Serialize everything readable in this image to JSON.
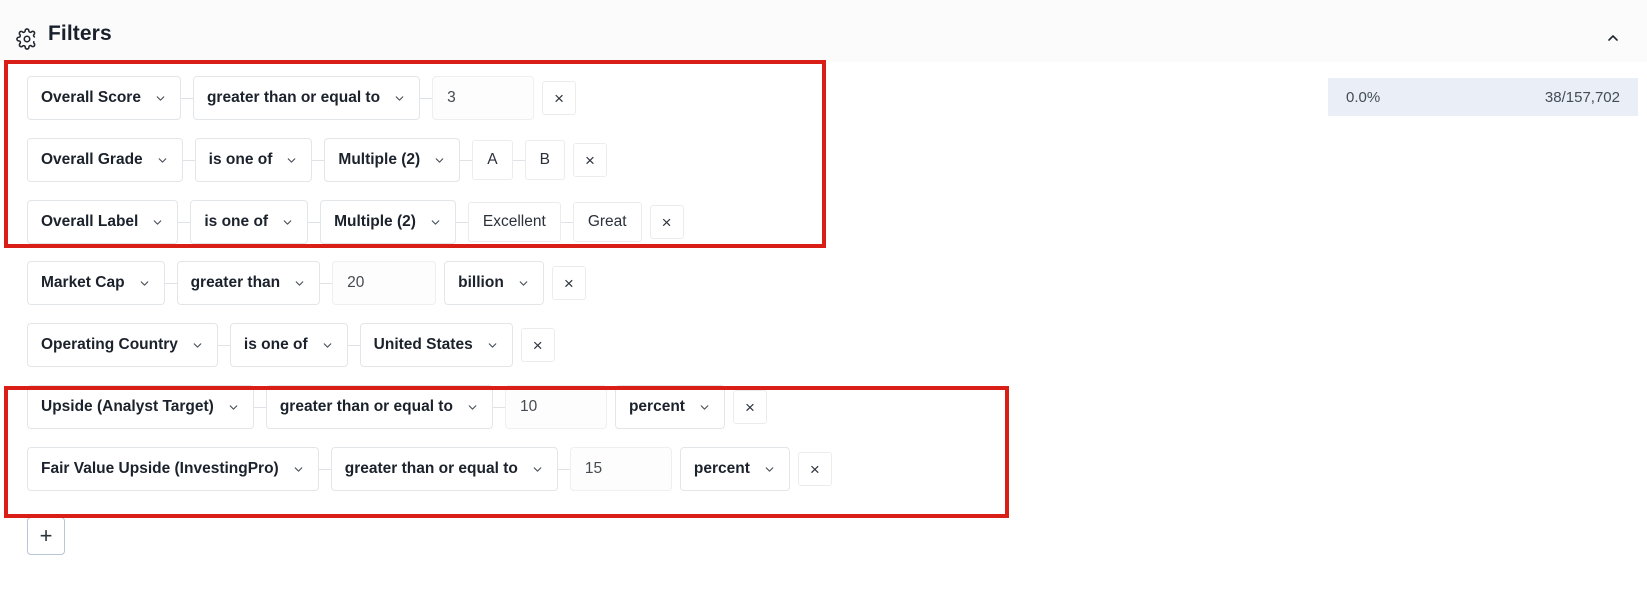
{
  "header": {
    "title": "Filters",
    "gear_icon": "gear-icon",
    "collapse_icon": "chevron-up-icon"
  },
  "stats": {
    "percent": "0.0%",
    "count": "38/157,702",
    "background": "#eaeff7"
  },
  "highlight": {
    "color": "#d91e18"
  },
  "icons": {
    "remove": "×",
    "add": "+",
    "chevron_down": "chevron-down-icon"
  },
  "filters": [
    {
      "field": "Overall Score",
      "operator": "greater than or equal to",
      "value": "3",
      "unit": null,
      "tags": [],
      "remove_label": "×"
    },
    {
      "field": "Overall Grade",
      "operator": "is one of",
      "value": "Multiple (2)",
      "unit": null,
      "tags": [
        "A",
        "B"
      ],
      "remove_label": "×"
    },
    {
      "field": "Overall Label",
      "operator": "is one of",
      "value": "Multiple (2)",
      "unit": null,
      "tags": [
        "Excellent",
        "Great"
      ],
      "remove_label": "×"
    },
    {
      "field": "Market Cap",
      "operator": "greater than",
      "value": "20",
      "unit": "billion",
      "tags": [],
      "remove_label": "×"
    },
    {
      "field": "Operating Country",
      "operator": "is one of",
      "value": "United States",
      "unit": null,
      "tags": [],
      "remove_label": "×"
    },
    {
      "field": "Upside (Analyst Target)",
      "operator": "greater than or equal to",
      "value": "10",
      "unit": "percent",
      "tags": [],
      "remove_label": "×"
    },
    {
      "field": "Fair Value Upside (InvestingPro)",
      "operator": "greater than or equal to",
      "value": "15",
      "unit": "percent",
      "tags": [],
      "remove_label": "×"
    }
  ],
  "add_button": {
    "label": "+"
  }
}
